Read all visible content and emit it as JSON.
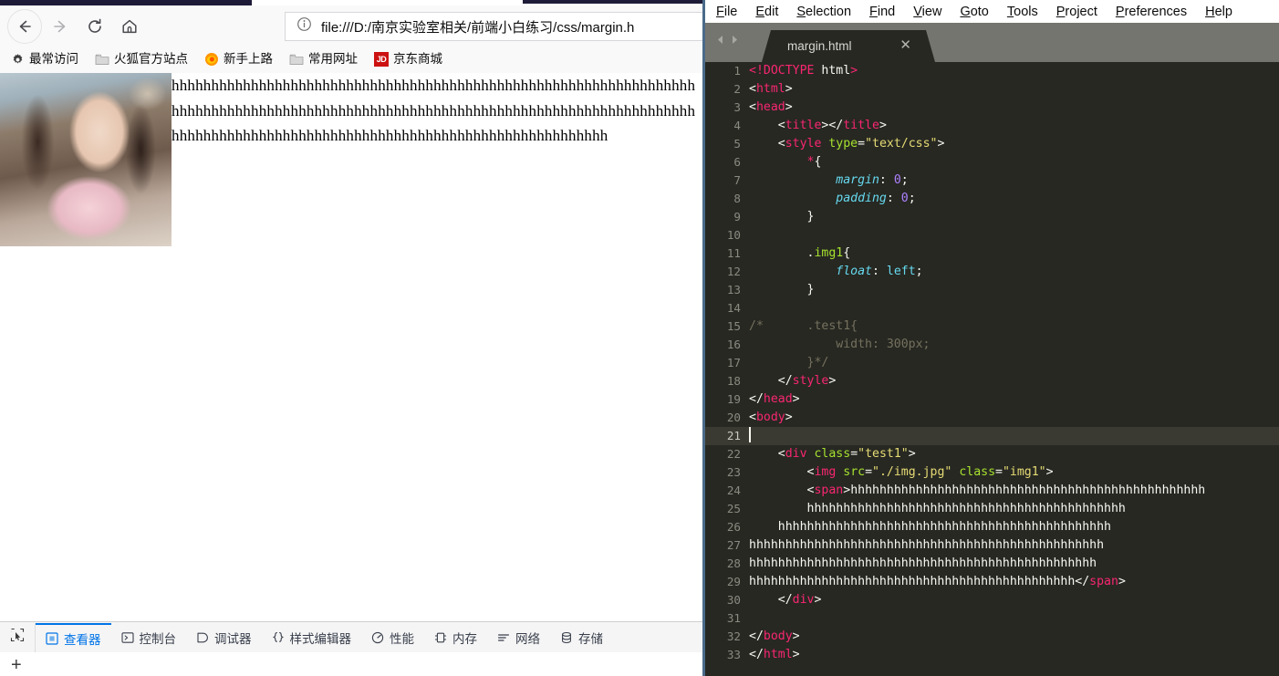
{
  "browser": {
    "nav": {
      "back_icon": "back-arrow-icon",
      "forward_icon": "forward-arrow-icon",
      "reload_icon": "reload-icon",
      "home_icon": "home-icon"
    },
    "urlbar": {
      "identity_icon": "info-icon",
      "url": "file:///D:/南京实验室相关/前端小白练习/css/margin.h"
    },
    "bookmarks": [
      {
        "label": "最常访问",
        "icon": "gear-icon"
      },
      {
        "label": "火狐官方站点",
        "icon": "folder-icon"
      },
      {
        "label": "新手上路",
        "icon": "firefox-icon"
      },
      {
        "label": "常用网址",
        "icon": "folder-icon"
      },
      {
        "label": "京东商城",
        "icon": "jd-badge-icon",
        "badge": "JD"
      }
    ],
    "page": {
      "image_alt": "img.jpg",
      "text": "hhhhhhhhhhhhhhhhhhhhhhhhhhhhhhhhhhhhhhhhhhhhhhhhhhhhhhhhhhhhhhhhhhhhhhhhhhhhhhhhhhhhhhhhhhhhhhhhhhhhhhhhhhhhhhhhhhhhhhhhhhhhhhhhhhhhhhhhhhhhhhhhhhhhhhhhhhhhhhhhhhhhhhhhhhhhhhhhhhhhhhhhhhh"
    },
    "devtools": {
      "picker_icon": "element-picker-icon",
      "tabs": [
        {
          "label": "查看器",
          "icon": "inspector-icon",
          "active": true
        },
        {
          "label": "控制台",
          "icon": "console-icon",
          "active": false
        },
        {
          "label": "调试器",
          "icon": "debugger-icon",
          "active": false
        },
        {
          "label": "样式编辑器",
          "icon": "style-editor-icon",
          "active": false
        },
        {
          "label": "性能",
          "icon": "performance-icon",
          "active": false
        },
        {
          "label": "内存",
          "icon": "memory-icon",
          "active": false
        },
        {
          "label": "网络",
          "icon": "network-icon",
          "active": false
        },
        {
          "label": "存储",
          "icon": "storage-icon",
          "active": false
        }
      ],
      "add_rule_label": "+"
    }
  },
  "editor": {
    "app": "Sublime Text",
    "menus": [
      "File",
      "Edit",
      "Selection",
      "Find",
      "View",
      "Goto",
      "Tools",
      "Project",
      "Preferences",
      "Help"
    ],
    "tab": {
      "filename": "margin.html",
      "close_icon": "close-icon",
      "prev_icon": "tab-prev-icon",
      "next_icon": "tab-next-icon"
    },
    "active_line": 21,
    "colors": {
      "background": "#272822",
      "tag": "#f92672",
      "attribute": "#a6e22e",
      "string": "#e6db74",
      "property": "#66d9ef",
      "number": "#ae81ff",
      "comment": "#75715e",
      "text": "#f8f8f2",
      "accent_blue": "#4b6a8a"
    },
    "lines": [
      {
        "n": 1,
        "tokens": [
          {
            "t": "<!",
            "c": "tag"
          },
          {
            "t": "DOCTYPE",
            "c": "tag"
          },
          {
            "t": " html",
            "c": "txt"
          },
          {
            "t": ">",
            "c": "tag"
          }
        ]
      },
      {
        "n": 2,
        "tokens": [
          {
            "t": "<",
            "c": "punc"
          },
          {
            "t": "html",
            "c": "tag"
          },
          {
            "t": ">",
            "c": "punc"
          }
        ]
      },
      {
        "n": 3,
        "tokens": [
          {
            "t": "<",
            "c": "punc"
          },
          {
            "t": "head",
            "c": "tag"
          },
          {
            "t": ">",
            "c": "punc"
          }
        ]
      },
      {
        "n": 4,
        "tokens": [
          {
            "t": "    <",
            "c": "punc"
          },
          {
            "t": "title",
            "c": "tag"
          },
          {
            "t": "></",
            "c": "punc"
          },
          {
            "t": "title",
            "c": "tag"
          },
          {
            "t": ">",
            "c": "punc"
          }
        ]
      },
      {
        "n": 5,
        "tokens": [
          {
            "t": "    <",
            "c": "punc"
          },
          {
            "t": "style",
            "c": "tag"
          },
          {
            "t": " ",
            "c": "txt"
          },
          {
            "t": "type",
            "c": "attr"
          },
          {
            "t": "=",
            "c": "punc"
          },
          {
            "t": "\"text/css\"",
            "c": "str"
          },
          {
            "t": ">",
            "c": "punc"
          }
        ]
      },
      {
        "n": 6,
        "tokens": [
          {
            "t": "        ",
            "c": "txt"
          },
          {
            "t": "*",
            "c": "tag"
          },
          {
            "t": "{",
            "c": "punc"
          }
        ]
      },
      {
        "n": 7,
        "tokens": [
          {
            "t": "            ",
            "c": "txt"
          },
          {
            "t": "margin",
            "c": "prop"
          },
          {
            "t": ": ",
            "c": "punc"
          },
          {
            "t": "0",
            "c": "val"
          },
          {
            "t": ";",
            "c": "punc"
          }
        ]
      },
      {
        "n": 8,
        "tokens": [
          {
            "t": "            ",
            "c": "txt"
          },
          {
            "t": "padding",
            "c": "prop"
          },
          {
            "t": ": ",
            "c": "punc"
          },
          {
            "t": "0",
            "c": "val"
          },
          {
            "t": ";",
            "c": "punc"
          }
        ]
      },
      {
        "n": 9,
        "tokens": [
          {
            "t": "        }",
            "c": "punc"
          }
        ]
      },
      {
        "n": 10,
        "tokens": []
      },
      {
        "n": 11,
        "tokens": [
          {
            "t": "        .",
            "c": "punc"
          },
          {
            "t": "img1",
            "c": "sel"
          },
          {
            "t": "{",
            "c": "punc"
          }
        ]
      },
      {
        "n": 12,
        "tokens": [
          {
            "t": "            ",
            "c": "txt"
          },
          {
            "t": "float",
            "c": "prop"
          },
          {
            "t": ": ",
            "c": "punc"
          },
          {
            "t": "left",
            "c": "kw"
          },
          {
            "t": ";",
            "c": "punc"
          }
        ]
      },
      {
        "n": 13,
        "tokens": [
          {
            "t": "        }",
            "c": "punc"
          }
        ]
      },
      {
        "n": 14,
        "tokens": []
      },
      {
        "n": 15,
        "tokens": [
          {
            "t": "/*      .test1{",
            "c": "cmt"
          }
        ]
      },
      {
        "n": 16,
        "tokens": [
          {
            "t": "            width: 300px;",
            "c": "cmt"
          }
        ]
      },
      {
        "n": 17,
        "tokens": [
          {
            "t": "        }*/",
            "c": "cmt"
          }
        ]
      },
      {
        "n": 18,
        "tokens": [
          {
            "t": "    </",
            "c": "punc"
          },
          {
            "t": "style",
            "c": "tag"
          },
          {
            "t": ">",
            "c": "punc"
          }
        ]
      },
      {
        "n": 19,
        "tokens": [
          {
            "t": "</",
            "c": "punc"
          },
          {
            "t": "head",
            "c": "tag"
          },
          {
            "t": ">",
            "c": "punc"
          }
        ]
      },
      {
        "n": 20,
        "tokens": [
          {
            "t": "<",
            "c": "punc"
          },
          {
            "t": "body",
            "c": "tag"
          },
          {
            "t": ">",
            "c": "punc"
          }
        ]
      },
      {
        "n": 21,
        "tokens": [],
        "cursor": true,
        "active": true
      },
      {
        "n": 22,
        "tokens": [
          {
            "t": "    <",
            "c": "punc"
          },
          {
            "t": "div",
            "c": "tag"
          },
          {
            "t": " ",
            "c": "txt"
          },
          {
            "t": "class",
            "c": "attr"
          },
          {
            "t": "=",
            "c": "punc"
          },
          {
            "t": "\"test1\"",
            "c": "str"
          },
          {
            "t": ">",
            "c": "punc"
          }
        ]
      },
      {
        "n": 23,
        "tokens": [
          {
            "t": "        <",
            "c": "punc"
          },
          {
            "t": "img",
            "c": "tag"
          },
          {
            "t": " ",
            "c": "txt"
          },
          {
            "t": "src",
            "c": "attr"
          },
          {
            "t": "=",
            "c": "punc"
          },
          {
            "t": "\"./img.jpg\"",
            "c": "str"
          },
          {
            "t": " ",
            "c": "txt"
          },
          {
            "t": "class",
            "c": "attr"
          },
          {
            "t": "=",
            "c": "punc"
          },
          {
            "t": "\"img1\"",
            "c": "str"
          },
          {
            "t": ">",
            "c": "punc"
          }
        ]
      },
      {
        "n": 24,
        "tokens": [
          {
            "t": "        <",
            "c": "punc"
          },
          {
            "t": "span",
            "c": "tag"
          },
          {
            "t": ">",
            "c": "punc"
          },
          {
            "t": "hhhhhhhhhhhhhhhhhhhhhhhhhhhhhhhhhhhhhhhhhhhhhhhhh",
            "c": "txt"
          }
        ]
      },
      {
        "n": 25,
        "tokens": [
          {
            "t": "        hhhhhhhhhhhhhhhhhhhhhhhhhhhhhhhhhhhhhhhhhhhh",
            "c": "txt"
          }
        ]
      },
      {
        "n": 26,
        "tokens": [
          {
            "t": "    hhhhhhhhhhhhhhhhhhhhhhhhhhhhhhhhhhhhhhhhhhhhhh",
            "c": "txt"
          }
        ]
      },
      {
        "n": 27,
        "tokens": [
          {
            "t": "hhhhhhhhhhhhhhhhhhhhhhhhhhhhhhhhhhhhhhhhhhhhhhhhh",
            "c": "txt"
          }
        ]
      },
      {
        "n": 28,
        "tokens": [
          {
            "t": "hhhhhhhhhhhhhhhhhhhhhhhhhhhhhhhhhhhhhhhhhhhhhhhh",
            "c": "txt"
          }
        ]
      },
      {
        "n": 29,
        "tokens": [
          {
            "t": "hhhhhhhhhhhhhhhhhhhhhhhhhhhhhhhhhhhhhhhhhhhhh",
            "c": "txt"
          },
          {
            "t": "</",
            "c": "punc"
          },
          {
            "t": "span",
            "c": "tag"
          },
          {
            "t": ">",
            "c": "punc"
          }
        ]
      },
      {
        "n": 30,
        "tokens": [
          {
            "t": "    </",
            "c": "punc"
          },
          {
            "t": "div",
            "c": "tag"
          },
          {
            "t": ">",
            "c": "punc"
          }
        ]
      },
      {
        "n": 31,
        "tokens": []
      },
      {
        "n": 32,
        "tokens": [
          {
            "t": "</",
            "c": "punc"
          },
          {
            "t": "body",
            "c": "tag"
          },
          {
            "t": ">",
            "c": "punc"
          }
        ]
      },
      {
        "n": 33,
        "tokens": [
          {
            "t": "</",
            "c": "punc"
          },
          {
            "t": "html",
            "c": "tag"
          },
          {
            "t": ">",
            "c": "punc"
          }
        ]
      }
    ]
  }
}
